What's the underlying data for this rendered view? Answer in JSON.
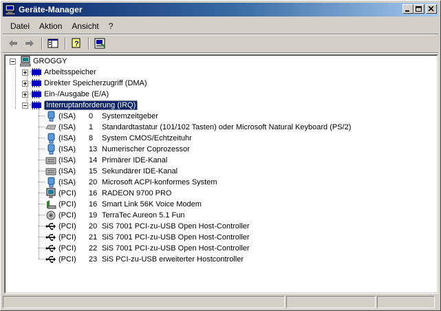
{
  "window": {
    "title": "Geräte-Manager"
  },
  "menu": [
    {
      "label": "Datei"
    },
    {
      "label": "Aktion"
    },
    {
      "label": "Ansicht"
    },
    {
      "label": "?"
    }
  ],
  "toolbar": {
    "icons": [
      "back-arrow-icon",
      "forward-arrow-icon",
      "show-hide-console-tree-icon",
      "help-icon",
      "properties-icon"
    ]
  },
  "tree": {
    "root": "GROGGY",
    "categories": [
      {
        "label": "Arbeitsspeicher",
        "expanded": false
      },
      {
        "label": "Direkter Speicherzugriff (DMA)",
        "expanded": false
      },
      {
        "label": "Ein-/Ausgabe (E/A)",
        "expanded": false
      },
      {
        "label": "Interruptanforderung (IRQ)",
        "expanded": true,
        "selected": true
      }
    ],
    "irq_entries": [
      {
        "bus": "(ISA)",
        "irq": "0",
        "device": "Systemzeitgeber",
        "icon": "system-device-icon"
      },
      {
        "bus": "(ISA)",
        "irq": "1",
        "device": "Standardtastatur (101/102 Tasten) oder Microsoft Natural Keyboard (PS/2)",
        "icon": "keyboard-icon"
      },
      {
        "bus": "(ISA)",
        "irq": "8",
        "device": "System CMOS/Echtzeituhr",
        "icon": "system-device-icon"
      },
      {
        "bus": "(ISA)",
        "irq": "13",
        "device": "Numerischer Coprozessor",
        "icon": "system-device-icon"
      },
      {
        "bus": "(ISA)",
        "irq": "14",
        "device": "Primärer IDE-Kanal",
        "icon": "ide-controller-icon"
      },
      {
        "bus": "(ISA)",
        "irq": "15",
        "device": "Sekundärer IDE-Kanal",
        "icon": "ide-controller-icon"
      },
      {
        "bus": "(ISA)",
        "irq": "20",
        "device": "Microsoft ACPI-konformes System",
        "icon": "system-device-icon"
      },
      {
        "bus": "(PCI)",
        "irq": "16",
        "device": "RADEON 9700 PRO",
        "icon": "display-adapter-icon"
      },
      {
        "bus": "(PCI)",
        "irq": "16",
        "device": "Smart Link 56K Voice Modem",
        "icon": "modem-icon"
      },
      {
        "bus": "(PCI)",
        "irq": "19",
        "device": "TerraTec Aureon 5.1 Fun",
        "icon": "sound-device-icon"
      },
      {
        "bus": "(PCI)",
        "irq": "20",
        "device": "SiS 7001 PCI-zu-USB Open Host-Controller",
        "icon": "usb-icon"
      },
      {
        "bus": "(PCI)",
        "irq": "21",
        "device": "SiS 7001 PCI-zu-USB Open Host-Controller",
        "icon": "usb-icon"
      },
      {
        "bus": "(PCI)",
        "irq": "22",
        "device": "SiS 7001 PCI-zu-USB Open Host-Controller",
        "icon": "usb-icon"
      },
      {
        "bus": "(PCI)",
        "irq": "23",
        "device": "SiS PCI-zu-USB erweiterter Hostcontroller",
        "icon": "usb-icon"
      }
    ]
  },
  "colors": {
    "title_gradient_start": "#0a246a",
    "title_gradient_end": "#a6caf0",
    "selection": "#0a246a",
    "face": "#d4d0c8"
  }
}
